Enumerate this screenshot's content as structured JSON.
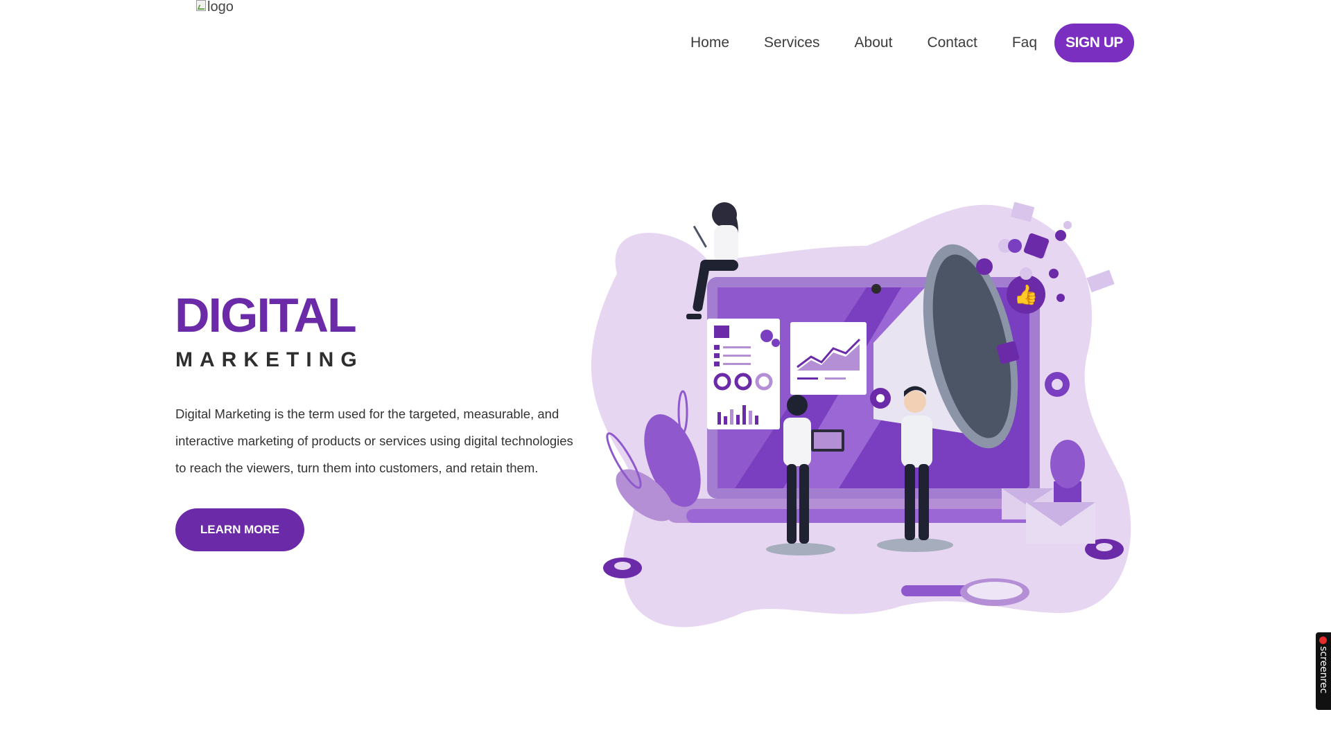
{
  "header": {
    "logo_alt": "logo",
    "nav": [
      {
        "label": "Home"
      },
      {
        "label": "Services"
      },
      {
        "label": "About"
      },
      {
        "label": "Contact"
      },
      {
        "label": "Faq"
      }
    ],
    "signup_label": "SIGN UP"
  },
  "hero": {
    "title": "DIGITAL",
    "subtitle": "MARKETING",
    "description": "Digital Marketing is the term used for the targeted, measurable, and interactive marketing of products or services using digital technologies to reach the viewers, turn them into customers, and retain them.",
    "cta_label": "LEARN MORE"
  },
  "screenrec": {
    "label": "screenrec"
  },
  "colors": {
    "accent": "#7a2fc0",
    "title": "#6b2aa8",
    "blob": "#e3d3f0",
    "purple_light": "#b48fd6"
  },
  "icons": [
    "broken-image-icon",
    "megaphone-icon",
    "thumbs-up-icon",
    "heart-icon",
    "gear-icon",
    "envelope-icon",
    "magnifier-icon",
    "laptop-icon",
    "record-dot-icon"
  ]
}
